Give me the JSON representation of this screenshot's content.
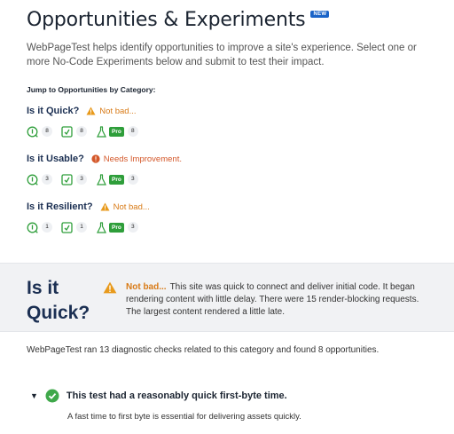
{
  "header": {
    "title": "Opportunities & Experiments",
    "badge": "NEW",
    "intro": "WebPageTest helps identify opportunities to improve a site's experience. Select one or more No-Code Experiments below and submit to test their impact."
  },
  "jump_label": "Jump to Opportunities by Category:",
  "categories": [
    {
      "name": "Is it Quick?",
      "status": "Not bad...",
      "level": "warning",
      "counts": {
        "opportunities": "8",
        "experiments": "8",
        "pro": "8"
      }
    },
    {
      "name": "Is it Usable?",
      "status": "Needs Improvement.",
      "level": "error",
      "counts": {
        "opportunities": "3",
        "experiments": "3",
        "pro": "3"
      }
    },
    {
      "name": "Is it Resilient?",
      "status": "Not bad...",
      "level": "warning",
      "counts": {
        "opportunities": "1",
        "experiments": "1",
        "pro": "3"
      }
    }
  ],
  "pro_label": "Pro",
  "section": {
    "title": "Is it Quick?",
    "status_lead": "Not bad...",
    "status_text": "This site was quick to connect and deliver initial code. It began rendering content with little delay. There were 15 render-blocking requests. The largest content rendered a little late.",
    "diagnostic": "WebPageTest ran 13 diagnostic checks related to this category and found 8 opportunities."
  },
  "check": {
    "title": "This test had a reasonably quick first-byte time.",
    "description": "A fast time to first byte is essential for delivering assets quickly."
  },
  "colors": {
    "warning": "#e89a1c",
    "error": "#d4582a",
    "success": "#3fa84a",
    "pro": "#2e9e3a",
    "heading": "#1b2f52"
  },
  "icons": [
    "warning-icon",
    "error-icon",
    "opportunity-icon",
    "experiment-icon",
    "flask-icon",
    "check-circle-icon",
    "chevron-down-icon"
  ]
}
